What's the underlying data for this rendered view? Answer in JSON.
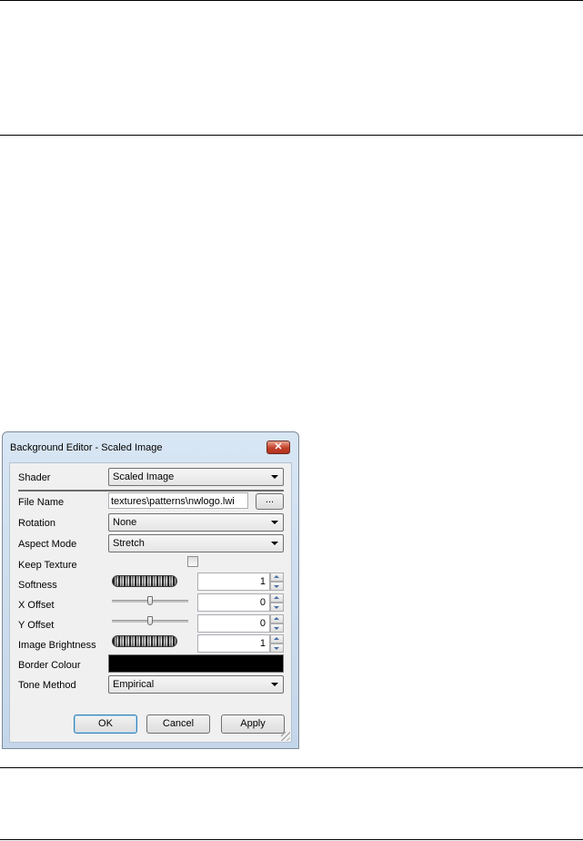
{
  "dialog": {
    "title": "Background Editor - Scaled Image",
    "close_label": "✕",
    "shader": {
      "label": "Shader",
      "value": "Scaled Image"
    },
    "file_name": {
      "label": "File Name",
      "value": "textures\\patterns\\nwlogo.lwi",
      "browse_label": "..."
    },
    "rotation": {
      "label": "Rotation",
      "value": "None"
    },
    "aspect_mode": {
      "label": "Aspect Mode",
      "value": "Stretch"
    },
    "keep_texture": {
      "label": "Keep Texture",
      "checked": false
    },
    "softness": {
      "label": "Softness",
      "value": "1"
    },
    "x_offset": {
      "label": "X Offset",
      "value": "0",
      "slider_fraction": 0.5
    },
    "y_offset": {
      "label": "Y Offset",
      "value": "0",
      "slider_fraction": 0.5
    },
    "image_brightness": {
      "label": "Image Brightness",
      "value": "1"
    },
    "border_colour": {
      "label": "Border Colour",
      "color": "#000000"
    },
    "tone_method": {
      "label": "Tone Method",
      "value": "Empirical"
    },
    "buttons": {
      "ok": "OK",
      "cancel": "Cancel",
      "apply": "Apply"
    }
  }
}
